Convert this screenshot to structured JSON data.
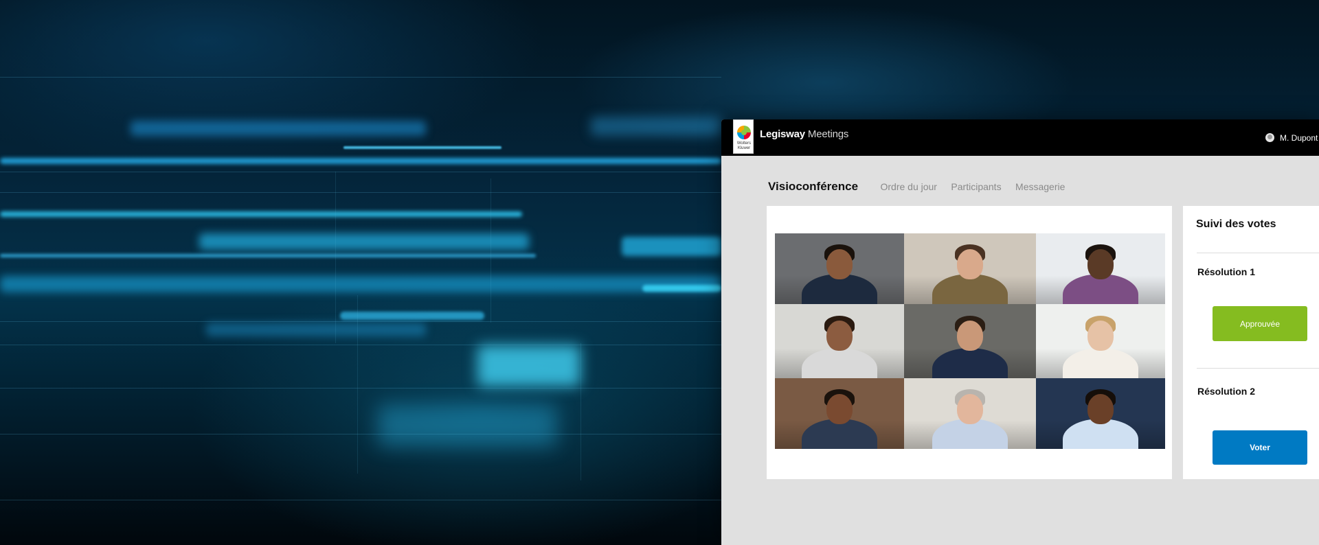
{
  "header": {
    "logo_text": "Wolters Kluwer",
    "brand_bold": "Legisway",
    "brand_light": "Meetings",
    "user_name": "M. Dupont"
  },
  "tabs": [
    {
      "label": "Visioconférence",
      "active": true
    },
    {
      "label": "Ordre du jour",
      "active": false
    },
    {
      "label": "Participants",
      "active": false
    },
    {
      "label": "Messagerie",
      "active": false
    }
  ],
  "video": {
    "participants": [
      {
        "bg": "#6b6d70",
        "skin": "#8a5a3c",
        "hair": "#1a120c",
        "shirt": "#1d2a3e"
      },
      {
        "bg": "#cfc7bb",
        "skin": "#d9a98b",
        "hair": "#4a3222",
        "shirt": "#7a6640"
      },
      {
        "bg": "#e9ecef",
        "skin": "#5a3a26",
        "hair": "#1b130e",
        "shirt": "#7c4e84"
      },
      {
        "bg": "#d8d8d4",
        "skin": "#8c5c40",
        "hair": "#2a1a10",
        "shirt": "#d9d9d9"
      },
      {
        "bg": "#6a6a66",
        "skin": "#c99878",
        "hair": "#2b1e14",
        "shirt": "#1e2c48"
      },
      {
        "bg": "#eef0ee",
        "skin": "#e6c2a6",
        "hair": "#c8a26a",
        "shirt": "#f3efe8"
      },
      {
        "bg": "#7a5a44",
        "skin": "#7a4a30",
        "hair": "#1a120c",
        "shirt": "#2c3a52"
      },
      {
        "bg": "#dedbd4",
        "skin": "#e2b69c",
        "hair": "#b8b4ae",
        "shirt": "#c4d2e6"
      },
      {
        "bg": "#243652",
        "skin": "#6a4028",
        "hair": "#150e09",
        "shirt": "#cfe0f2"
      }
    ]
  },
  "votes": {
    "title": "Suivi des votes",
    "resolutions": [
      {
        "title": "Résolution 1",
        "button_label": "Approuvée",
        "status": "approved",
        "color": "#85bc20"
      },
      {
        "title": "Résolution 2",
        "button_label": "Voter",
        "status": "open",
        "color": "#007ac3"
      }
    ]
  }
}
